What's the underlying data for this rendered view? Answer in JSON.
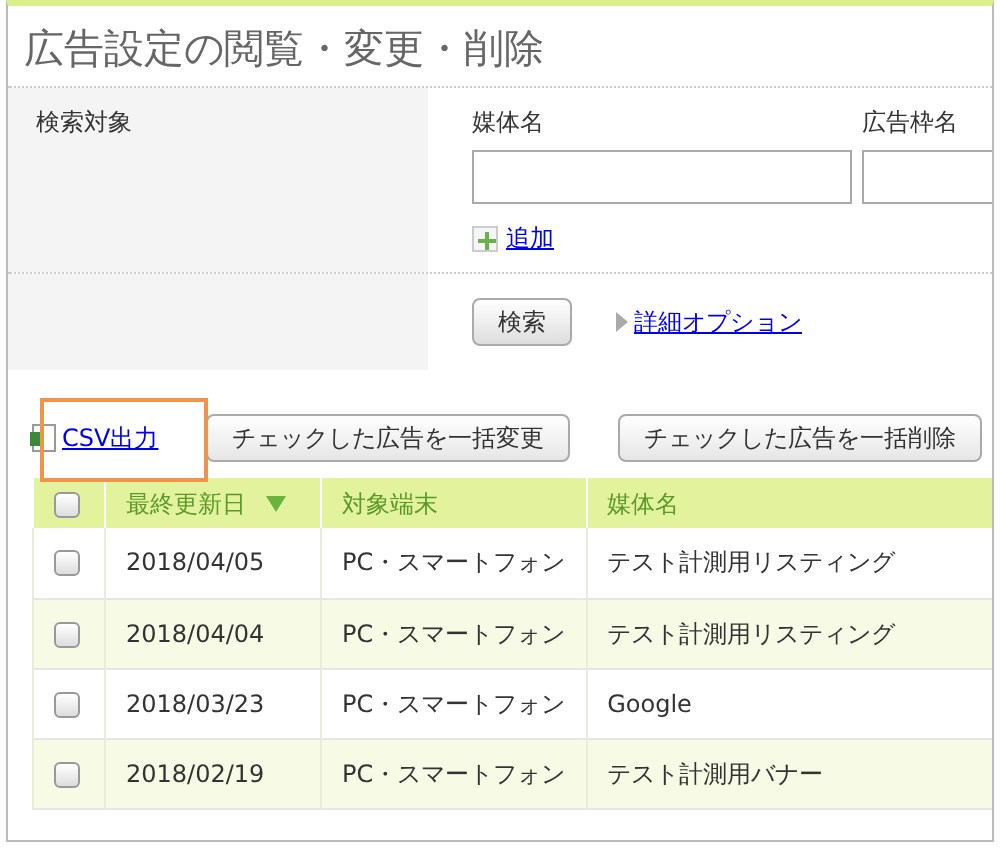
{
  "page": {
    "title": "広告設定の閲覧・変更・削除"
  },
  "search": {
    "label": "検索対象",
    "fields": [
      {
        "label": "媒体名"
      },
      {
        "label": "広告枠名"
      }
    ],
    "add_link": "追加",
    "search_button": "検索",
    "options_link": "詳細オプション"
  },
  "toolbar": {
    "csv_link": "CSV出力",
    "csv_highlighted": true,
    "buttons": [
      "チェックした広告を一括変更",
      "チェックした広告を一括削除"
    ]
  },
  "table": {
    "header_checked": false,
    "columns": [
      {
        "label": "最終更新日",
        "sorted": true
      },
      {
        "label": "対象端末",
        "sorted": false
      },
      {
        "label": "媒体名",
        "sorted": false
      }
    ],
    "rows": [
      {
        "checked": false,
        "cells": [
          "2018/04/05",
          "PC・スマートフォン",
          "テスト計測用リスティング"
        ]
      },
      {
        "checked": false,
        "cells": [
          "2018/04/04",
          "PC・スマートフォン",
          "テスト計測用リスティング"
        ]
      },
      {
        "checked": false,
        "cells": [
          "2018/03/23",
          "PC・スマートフォン",
          "Google"
        ]
      },
      {
        "checked": false,
        "cells": [
          "2018/02/19",
          "PC・スマートフォン",
          "テスト計測用バナー"
        ]
      }
    ]
  }
}
